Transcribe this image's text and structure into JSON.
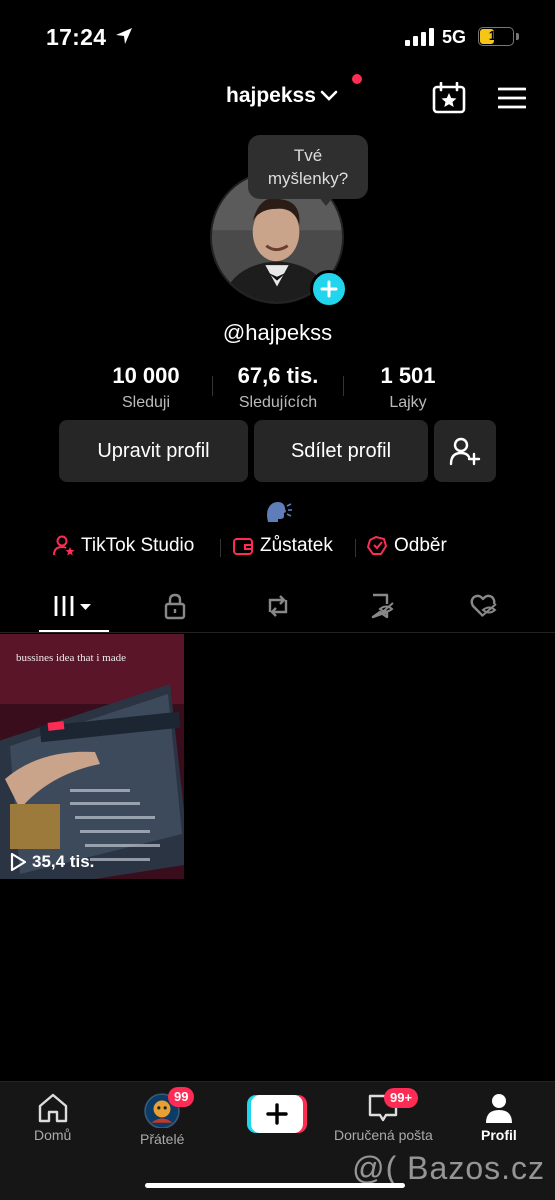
{
  "status_bar": {
    "time": "17:24",
    "network": "5G",
    "battery": "17"
  },
  "header": {
    "username": "hajpekss"
  },
  "profile": {
    "bubble_line1": "Tvé",
    "bubble_line2": "myšlenky?",
    "handle": "@hajpekss"
  },
  "stats": [
    {
      "value": "10 000",
      "label": "Sleduji"
    },
    {
      "value": "67,6 tis.",
      "label": "Sledujících"
    },
    {
      "value": "1 501",
      "label": "Lajky"
    }
  ],
  "actions": {
    "edit": "Upravit profil",
    "share": "Sdílet profil"
  },
  "links": [
    {
      "label": "TikTok Studio",
      "icon": "studio-icon"
    },
    {
      "label": "Zůstatek",
      "icon": "wallet-icon"
    },
    {
      "label": "Odběr",
      "icon": "subscription-icon"
    }
  ],
  "video": {
    "caption": "bussines idea that i made",
    "views": "35,4 tis."
  },
  "nav": [
    {
      "label": "Domů",
      "icon": "home-icon"
    },
    {
      "label": "Přátelé",
      "icon": "friends-icon",
      "badge": "99"
    },
    {
      "label": "",
      "icon": "create-icon"
    },
    {
      "label": "Doručená pošta",
      "icon": "inbox-icon",
      "badge": "99+"
    },
    {
      "label": "Profil",
      "icon": "profile-icon"
    }
  ],
  "watermark": "@( Bazos.cz",
  "colors": {
    "accent": "#fe2c55",
    "cyan": "#20d5ec",
    "background": "#000000"
  }
}
